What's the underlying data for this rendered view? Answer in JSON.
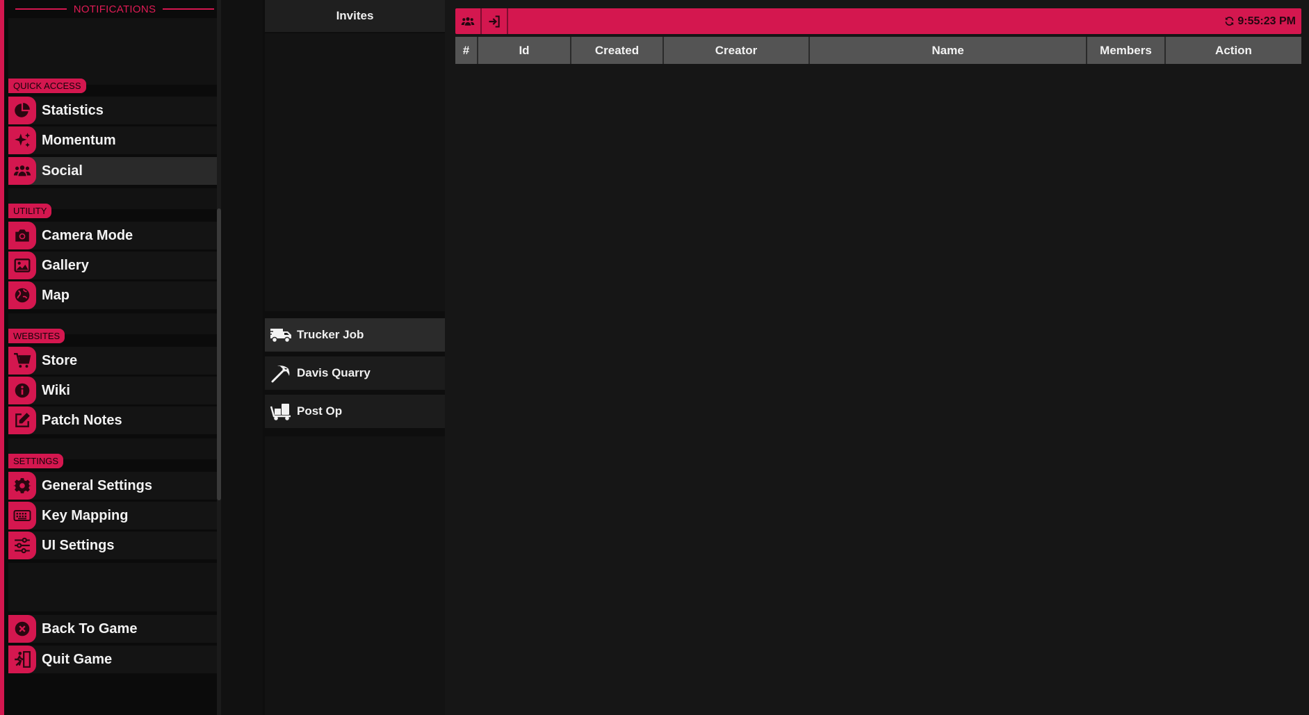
{
  "sidebar": {
    "notifications_title": "NOTIFICATIONS",
    "sections": {
      "quick_access": "QUICK ACCESS",
      "utility": "UTILITY",
      "websites": "WEBSITES",
      "settings": "SETTINGS"
    },
    "items": {
      "statistics": "Statistics",
      "momentum": "Momentum",
      "social": "Social",
      "camera_mode": "Camera Mode",
      "gallery": "Gallery",
      "map": "Map",
      "store": "Store",
      "wiki": "Wiki",
      "patch_notes": "Patch Notes",
      "general_settings": "General Settings",
      "key_mapping": "Key Mapping",
      "ui_settings": "UI Settings",
      "back_to_game": "Back To Game",
      "quit_game": "Quit Game"
    },
    "active_item": "Social"
  },
  "middle": {
    "invites_tab": "Invites",
    "jobs": [
      {
        "label": "Trucker Job",
        "icon": "truck-icon"
      },
      {
        "label": "Davis Quarry",
        "icon": "pickaxe-icon"
      },
      {
        "label": "Post Op",
        "icon": "dolly-icon"
      }
    ]
  },
  "main": {
    "toolbar": {
      "buttons": [
        {
          "icon": "group-icon"
        },
        {
          "icon": "join-icon"
        }
      ],
      "time": "9:55:23 PM"
    },
    "table": {
      "columns": [
        "#",
        "Id",
        "Created",
        "Creator",
        "Name",
        "Members",
        "Action"
      ],
      "rows": []
    }
  },
  "colors": {
    "accent": "#d4174f",
    "background": "#0d0d0d",
    "panel": "#161616",
    "table_header": "#545454"
  }
}
